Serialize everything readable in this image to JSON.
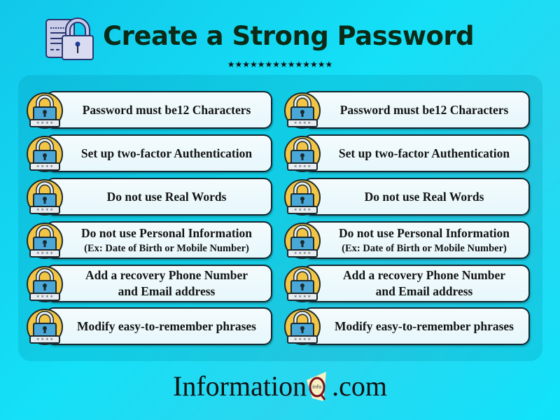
{
  "header": {
    "title": "Create a Strong Password",
    "stars": "★★★★★★★★★★★★★★",
    "icon": "document-padlock-icon"
  },
  "colors": {
    "background": "#14e0f7",
    "title_text": "#0c2a16",
    "card_fill": "#eef9fc",
    "card_border": "#13262e",
    "lock_circle": "#f2c544",
    "lock_body": "#4aa8d8",
    "logo_q": "#7a1020",
    "logo_badge": "#f7f0c2"
  },
  "columns": [
    {
      "tips": [
        {
          "line1": "Password must be12 Characters"
        },
        {
          "line1": "Set up two-factor Authentication"
        },
        {
          "line1": "Do not use Real Words"
        },
        {
          "line1": "Do not use Personal Information",
          "line2": "(Ex: Date of Birth or Mobile Number)"
        },
        {
          "line1": "Add a recovery Phone Number",
          "line2": "and Email address"
        },
        {
          "line1": "Modify easy-to-remember phrases"
        }
      ]
    },
    {
      "tips": [
        {
          "line1": "Password must be12 Characters"
        },
        {
          "line1": "Set up two-factor Authentication"
        },
        {
          "line1": "Do not use Real Words"
        },
        {
          "line1": "Do not use Personal Information",
          "line2": "(Ex: Date of Birth or Mobile Number)"
        },
        {
          "line1": "Add a recovery Phone Number",
          "line2": "and Email address"
        },
        {
          "line1": "Modify easy-to-remember phrases"
        }
      ]
    }
  ],
  "lock_icon": {
    "name": "padlock-password-icon",
    "mask": "****"
  },
  "footer": {
    "brand_prefix": "Information",
    "brand_q": "Q",
    "brand_badge": "info",
    "brand_suffix": ".com"
  }
}
